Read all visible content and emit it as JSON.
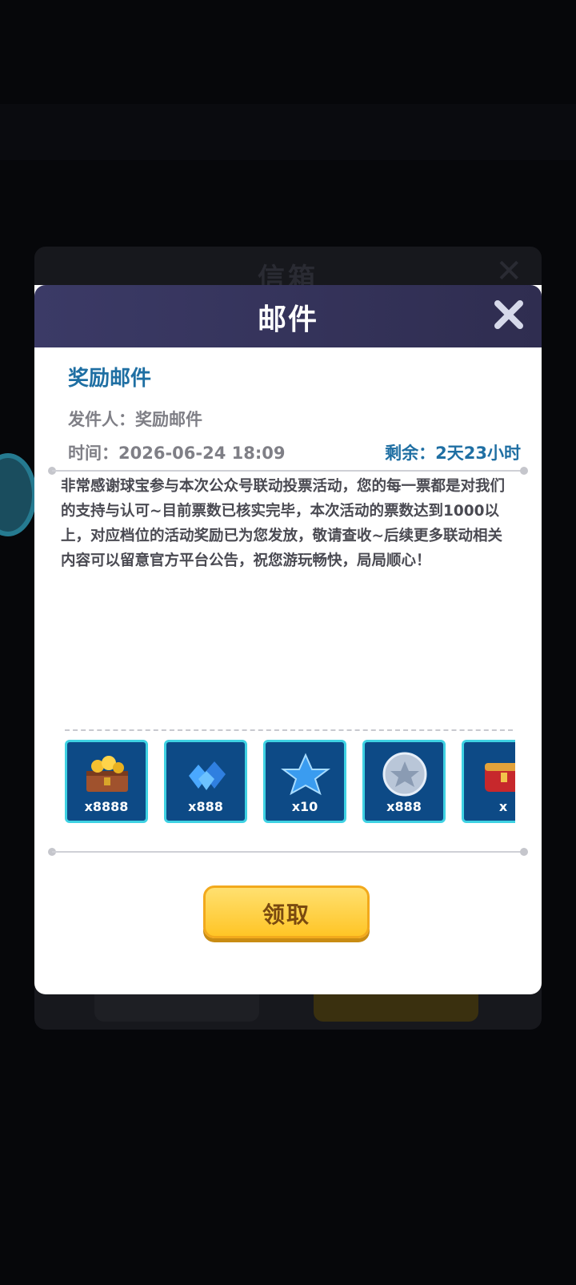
{
  "background": {
    "inbox_title": "信箱",
    "inbox_close": "✕"
  },
  "modal": {
    "title": "邮件",
    "close_icon": "close-icon"
  },
  "mail": {
    "subject": "奖励邮件",
    "sender": "发件人：奖励邮件",
    "time": "时间：2026-06-24 18:09",
    "remaining": "剩余：2天23小时",
    "body": "非常感谢球宝参与本次公众号联动投票活动，您的每一票都是对我们的支持与认可~目前票数已核实完毕，本次活动的票数达到1000以上，对应档位的活动奖励已为您发放，敬请查收~后续更多联动相关内容可以留意官方平台公告，祝您游玩畅快，局局顺心！"
  },
  "rewards": [
    {
      "icon": "treasure-chest-gold-icon",
      "qty": "x8888"
    },
    {
      "icon": "blue-gems-icon",
      "qty": "x888"
    },
    {
      "icon": "blue-star-icon",
      "qty": "x10"
    },
    {
      "icon": "silver-star-coin-icon",
      "qty": "x888"
    },
    {
      "icon": "red-chest-icon",
      "qty": "x"
    }
  ],
  "claim_button": "领取",
  "colors": {
    "accent_blue": "#1f6fa3",
    "header": "#3b3a66",
    "claim_yellow": "#ffc526",
    "reward_tile": "#0d4a86"
  }
}
